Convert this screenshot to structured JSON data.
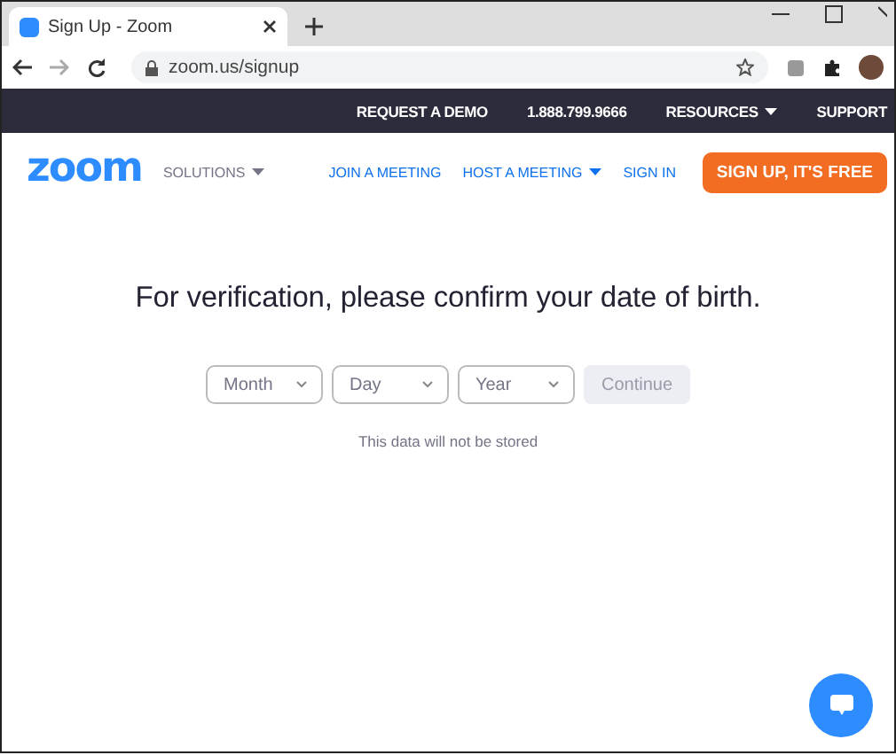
{
  "browser": {
    "tab_title": "Sign Up - Zoom",
    "url": "zoom.us/signup"
  },
  "top_bar": {
    "links": [
      {
        "label": "REQUEST A DEMO",
        "dropdown": false
      },
      {
        "label": "1.888.799.9666",
        "dropdown": false
      },
      {
        "label": "RESOURCES",
        "dropdown": true
      },
      {
        "label": "SUPPORT",
        "dropdown": false
      }
    ]
  },
  "nav": {
    "logo": "zoom",
    "solutions": "SOLUTIONS",
    "links": [
      {
        "label": "JOIN A MEETING",
        "dropdown": false
      },
      {
        "label": "HOST A MEETING",
        "dropdown": true
      },
      {
        "label": "SIGN IN",
        "dropdown": false
      }
    ],
    "signup": "SIGN UP, IT'S FREE"
  },
  "main": {
    "heading": "For verification, please confirm your date of birth.",
    "selects": [
      {
        "placeholder": "Month"
      },
      {
        "placeholder": "Day"
      },
      {
        "placeholder": "Year"
      }
    ],
    "continue": {
      "label": "Continue",
      "disabled": true
    },
    "note": "This data will not be stored"
  }
}
